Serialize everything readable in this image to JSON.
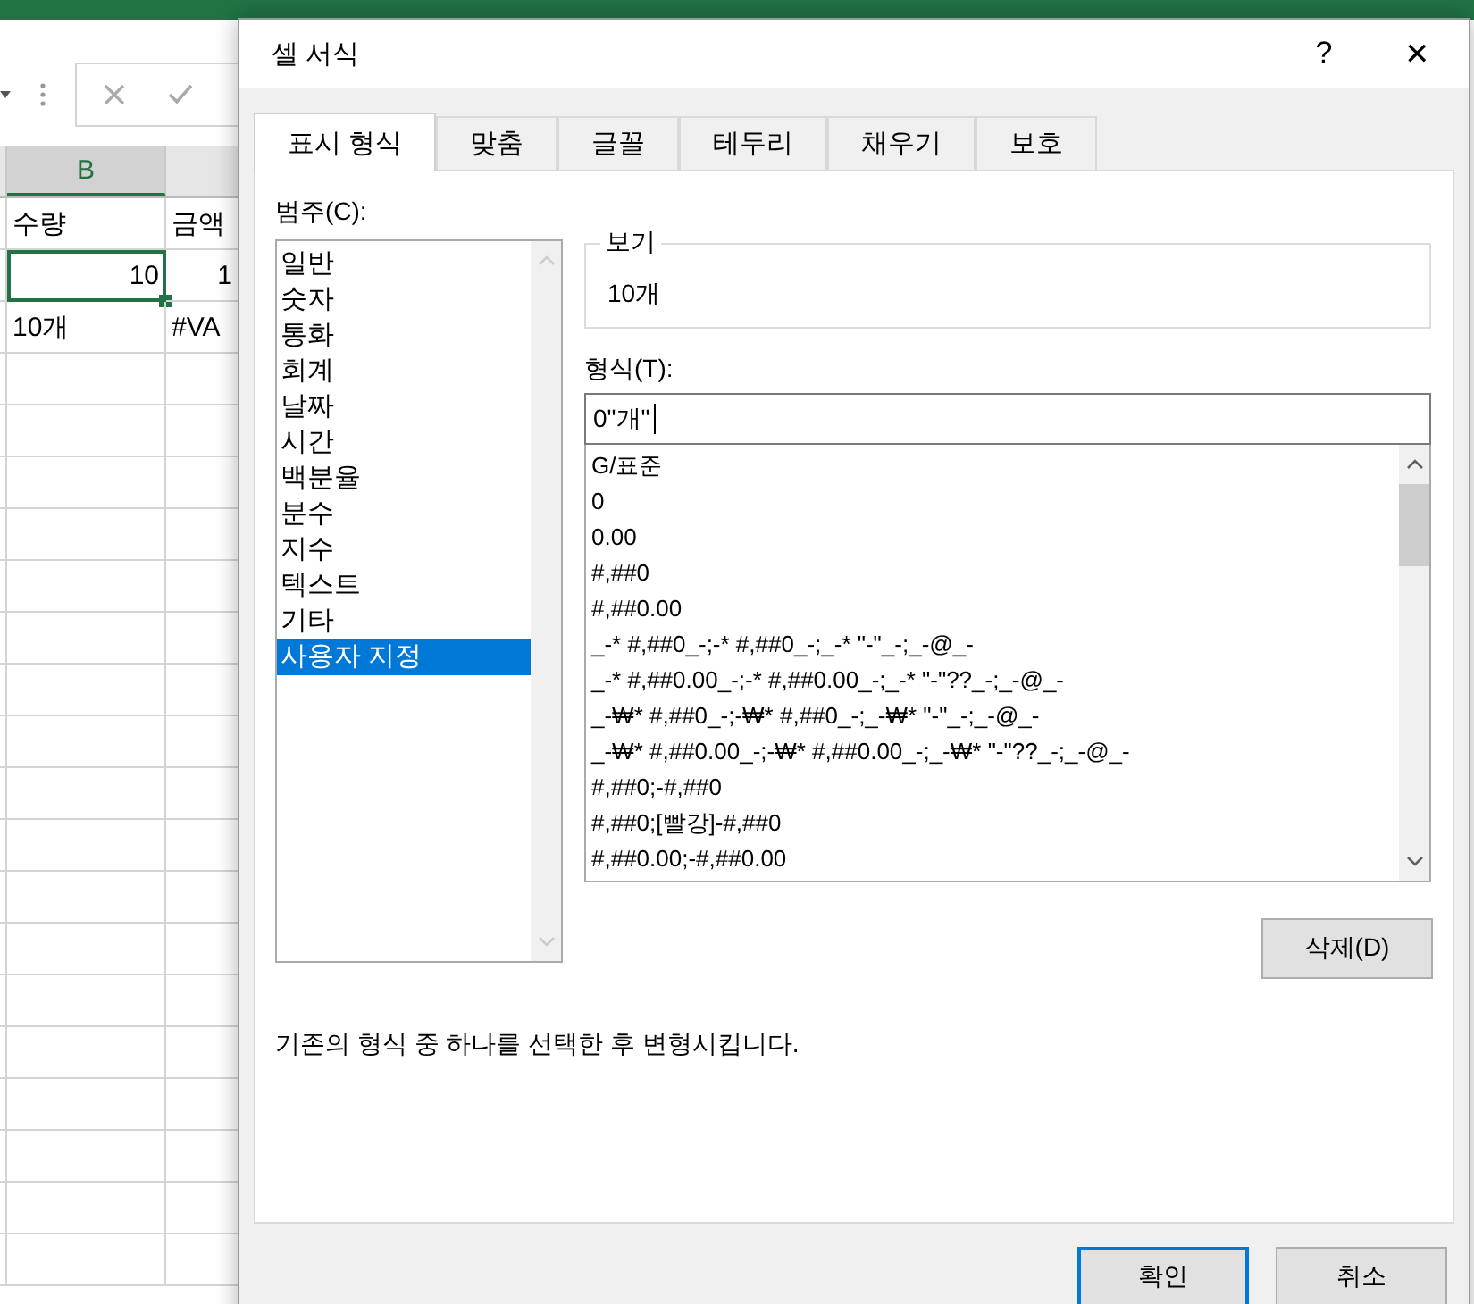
{
  "sheet": {
    "columns": [
      {
        "label": "B",
        "selected": true
      }
    ],
    "rows": [
      [
        {
          "text": "수량",
          "kind": "text",
          "selected": false
        },
        {
          "text": "금액",
          "kind": "text",
          "selected": false
        }
      ],
      [
        {
          "text": "10",
          "kind": "number",
          "selected": true
        },
        {
          "text": "1",
          "kind": "number",
          "selected": false
        }
      ],
      [
        {
          "text": "10개",
          "kind": "text",
          "selected": false
        },
        {
          "text": "#VA",
          "kind": "text",
          "selected": false
        }
      ]
    ]
  },
  "dialog": {
    "title": "셀 서식",
    "help": "?",
    "close": "✕",
    "tabs": [
      {
        "label": "표시 형식",
        "selected": true
      },
      {
        "label": "맞춤",
        "selected": false
      },
      {
        "label": "글꼴",
        "selected": false
      },
      {
        "label": "테두리",
        "selected": false
      },
      {
        "label": "채우기",
        "selected": false
      },
      {
        "label": "보호",
        "selected": false
      }
    ],
    "category_label": "범주(C):",
    "categories": [
      {
        "label": "일반",
        "selected": false
      },
      {
        "label": "숫자",
        "selected": false
      },
      {
        "label": "통화",
        "selected": false
      },
      {
        "label": "회계",
        "selected": false
      },
      {
        "label": "날짜",
        "selected": false
      },
      {
        "label": "시간",
        "selected": false
      },
      {
        "label": "백분율",
        "selected": false
      },
      {
        "label": "분수",
        "selected": false
      },
      {
        "label": "지수",
        "selected": false
      },
      {
        "label": "텍스트",
        "selected": false
      },
      {
        "label": "기타",
        "selected": false
      },
      {
        "label": "사용자 지정",
        "selected": true
      }
    ],
    "sample": {
      "label": "보기",
      "value": "10개"
    },
    "format_label": "형식(T):",
    "format_value": "0\"개\"",
    "formats": [
      "G/표준",
      "0",
      "0.00",
      "#,##0",
      "#,##0.00",
      "_-* #,##0_-;-* #,##0_-;_-* \"-\"_-;_-@_-",
      "_-* #,##0.00_-;-* #,##0.00_-;_-* \"-\"??_-;_-@_-",
      "_-₩* #,##0_-;-₩* #,##0_-;_-₩* \"-\"_-;_-@_-",
      "_-₩* #,##0.00_-;-₩* #,##0.00_-;_-₩* \"-\"??_-;_-@_-",
      "#,##0;-#,##0",
      "#,##0;[빨강]-#,##0",
      "#,##0.00;-#,##0.00"
    ],
    "delete_button": "삭제(D)",
    "description": "기존의 형식 중 하나를 선택한 후 변형시킵니다.",
    "ok_button": "확인",
    "cancel_button": "취소"
  }
}
